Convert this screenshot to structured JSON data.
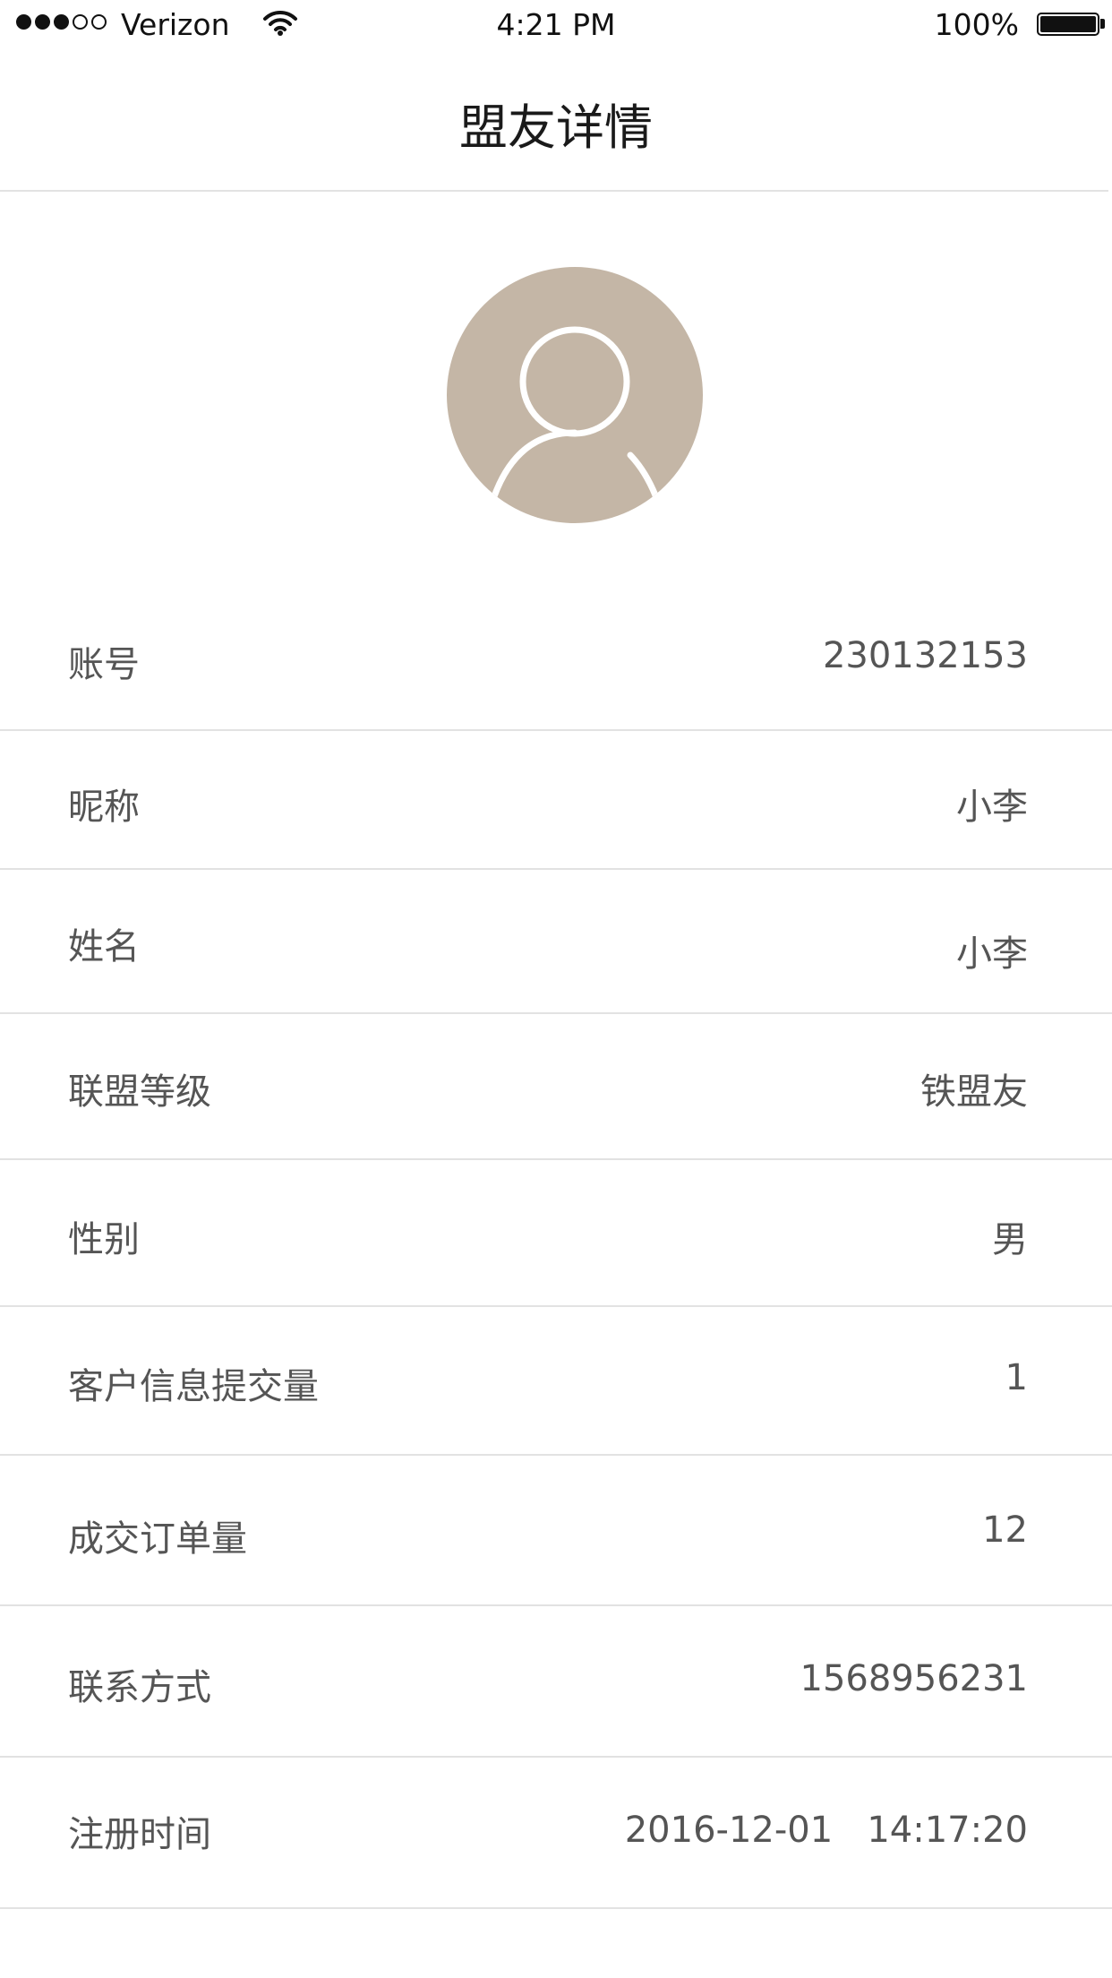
{
  "status_bar": {
    "carrier": "Verizon",
    "time": "4:21 PM",
    "battery": "100%",
    "signal_bars": 3
  },
  "nav": {
    "title": "盟友详情"
  },
  "avatar": {
    "icon": "user-avatar-icon",
    "color": "#c4b6a6"
  },
  "rows": [
    {
      "label": "账号",
      "value": "230132153"
    },
    {
      "label": "昵称",
      "value": "小李"
    },
    {
      "label": "姓名",
      "value": "小李"
    },
    {
      "label": "联盟等级",
      "value": "铁盟友"
    },
    {
      "label": "性别",
      "value": "男"
    },
    {
      "label": "客户信息提交量",
      "value": "1"
    },
    {
      "label": "成交订单量",
      "value": "12"
    },
    {
      "label": "联系方式",
      "value": "1568956231"
    },
    {
      "label": "注册时间",
      "value": "2016-12-01   14:17:20"
    }
  ]
}
